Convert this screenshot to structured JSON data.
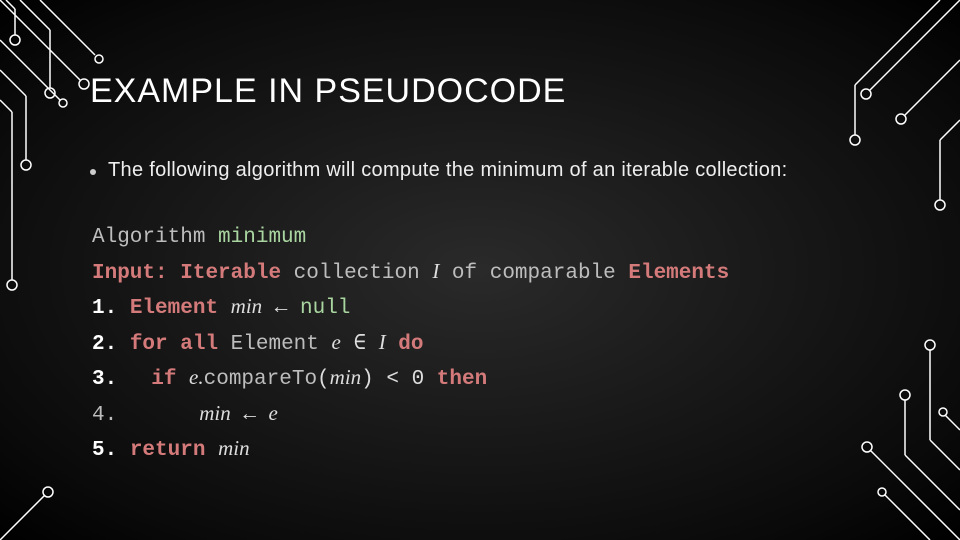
{
  "title": "EXAMPLE IN PSEUDOCODE",
  "bullet": "The following algorithm will compute the minimum of an iterable collection:",
  "pseudo": {
    "algo_kw": "Algorithm",
    "algo_name": "minimum",
    "input_kw": "Input:",
    "input_iterable": "Iterable",
    "input_collection": "collection",
    "input_I": "I",
    "input_of": "of comparable",
    "input_elements": "Elements",
    "n1": "1.",
    "l1_element": "Element",
    "l1_min": "min",
    "l1_arrow": "←",
    "l1_null": "null",
    "n2": "2.",
    "l2_forall": "for all",
    "l2_element": "Element",
    "l2_e": "e",
    "l2_in": "∈",
    "l2_I": "I",
    "l2_do": "do",
    "n3": "3.",
    "l3_if": "if",
    "l3_e": "e.",
    "l3_compare": "compareTo",
    "l3_open": "(",
    "l3_min": "min",
    "l3_close": ")",
    "l3_lt": "< 0",
    "l3_then": "then",
    "n4": "4.",
    "l4_min": "min",
    "l4_arrow": "←",
    "l4_e": "e",
    "n5": "5.",
    "l5_return": "return",
    "l5_min": "min"
  }
}
